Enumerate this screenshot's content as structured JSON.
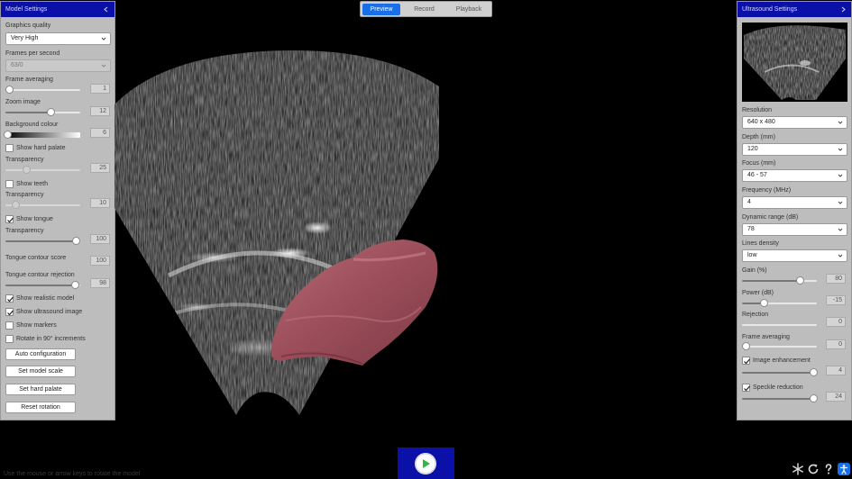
{
  "left_panel": {
    "title": "Model Settings",
    "graphics_quality_label": "Graphics quality",
    "graphics_quality_value": "Very High",
    "fps_label": "Frames per second",
    "fps_value": "63/0",
    "frame_averaging_label": "Frame averaging",
    "frame_averaging_value": "1",
    "zoom_label": "Zoom image",
    "zoom_value": "12",
    "background_label": "Background colour",
    "background_value": "6",
    "show_hard_palate": "Show hard palate",
    "transparency_label": "Transparency",
    "transparency_palate_value": "25",
    "show_teeth": "Show teeth",
    "transparency_teeth_value": "10",
    "show_tongue": "Show tongue",
    "transparency_tongue_value": "100",
    "contour_score_label": "Tongue contour score",
    "contour_score_value": "100",
    "contour_rejection_label": "Tongue contour rejection",
    "contour_rejection_value": "98",
    "show_realistic": "Show realistic model",
    "show_ultrasound": "Show ultrasound image",
    "show_markers": "Show markers",
    "rotate_90": "Rotate in 90° increments",
    "auto_config": "Auto configuration",
    "set_model_scale": "Set model scale",
    "set_hard_palate": "Set hard palate",
    "reset_rotation": "Reset rotation"
  },
  "tabs": {
    "preview": "Preview",
    "record": "Record",
    "playback": "Playback"
  },
  "right_panel": {
    "title": "Ultrasound Settings",
    "resolution_label": "Resolution",
    "resolution_value": "640 x 480",
    "depth_label": "Depth (mm)",
    "depth_value": "120",
    "focus_label": "Focus (mm)",
    "focus_value": "46 - 57",
    "frequency_label": "Frequency (MHz)",
    "frequency_value": "4",
    "dynamic_range_label": "Dynamic range (dB)",
    "dynamic_range_value": "78",
    "lines_density_label": "Lines density",
    "lines_density_value": "low",
    "gain_label": "Gain (%)",
    "gain_value": "80",
    "power_label": "Power (dB)",
    "power_value": "-15",
    "rejection_label": "Rejection",
    "rejection_value": "0",
    "frame_averaging_label": "Frame averaging",
    "frame_averaging_value": "0",
    "image_enhancement": "Image enhancement",
    "image_enhancement_value": "4",
    "speckle_reduction": "Speckle reduction",
    "speckle_reduction_value": "24"
  },
  "footer": {
    "hint": "Use the mouse or arrow keys to rotate the model"
  },
  "colors": {
    "panel_header": "#0a10a8",
    "panel_bg": "#bdbdbd",
    "tab_active": "#1a6fe8",
    "play_green": "#2fb84a"
  }
}
